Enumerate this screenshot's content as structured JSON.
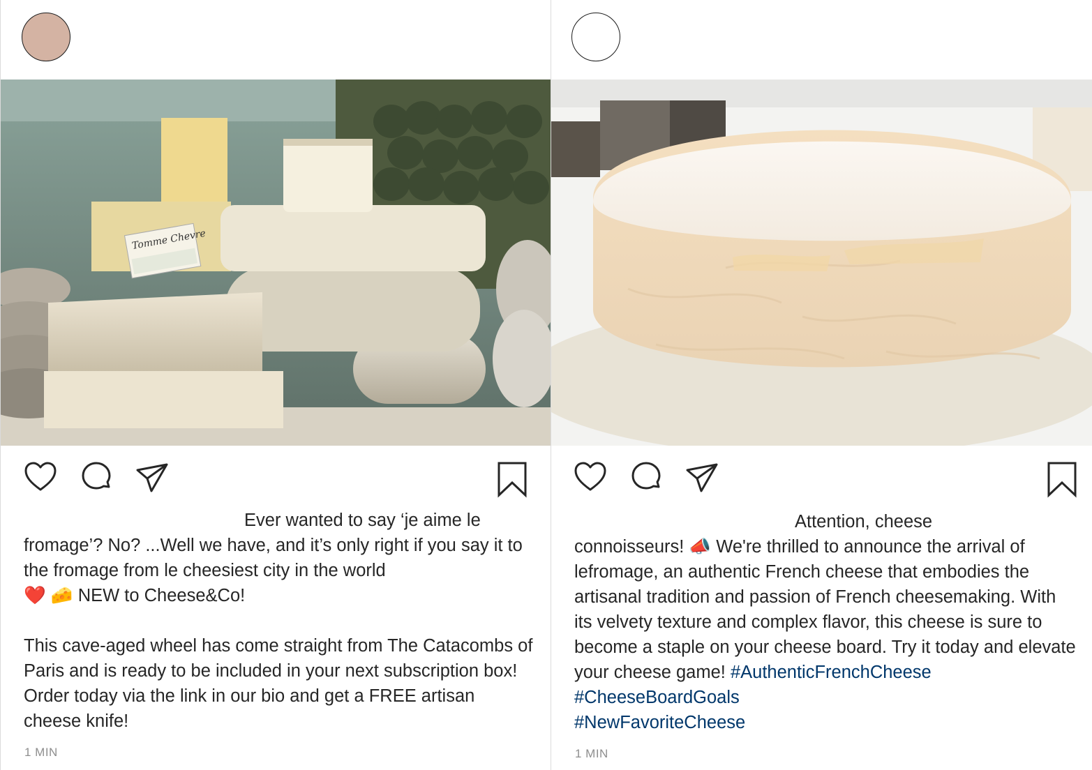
{
  "posts": [
    {
      "avatar_color": "#d4b3a3",
      "photo_subject": "cheese-market-photo",
      "caption": {
        "line1": "Ever wanted to say ‘je aime le",
        "body": "fromage’? No? ...Well we have, and it’s only right if you say it to the fromage from le cheesiest city in the world",
        "emoji_heart": "❤️",
        "emoji_cheese": "🧀",
        "tail": " NEW to Cheese&Co!",
        "paragraph2": "This cave-aged wheel has come straight from The Catacombs of Paris and is ready to be included in your next subscription box! Order today via the link in our bio and get a FREE artisan cheese knife!"
      },
      "timestamp": "1 MIN"
    },
    {
      "avatar_color": "#ffffff",
      "photo_subject": "brie-wheel-photo",
      "caption": {
        "line1": "Attention, cheese",
        "body_start": "connoisseurs! ",
        "emoji_megaphone": "📣",
        "body": " We're thrilled to announce the arrival of lefromage, an authentic French cheese that embodies the artisanal tradition and passion of French cheesemaking. With its velvety texture and complex flavor, this cheese is sure to become a staple on your cheese board. Try it today and elevate your cheese game! ",
        "hashtags": [
          "#AuthenticFrenchCheese",
          "#CheeseBoardGoals",
          "#NewFavoriteCheese"
        ]
      },
      "timestamp": "1 MIN"
    }
  ],
  "icons": [
    "heart-icon",
    "comment-icon",
    "share-icon",
    "bookmark-icon"
  ],
  "colors": {
    "text": "#262626",
    "hashtag": "#00376b",
    "muted": "#8e8e8e",
    "border": "#dbdbdb"
  }
}
